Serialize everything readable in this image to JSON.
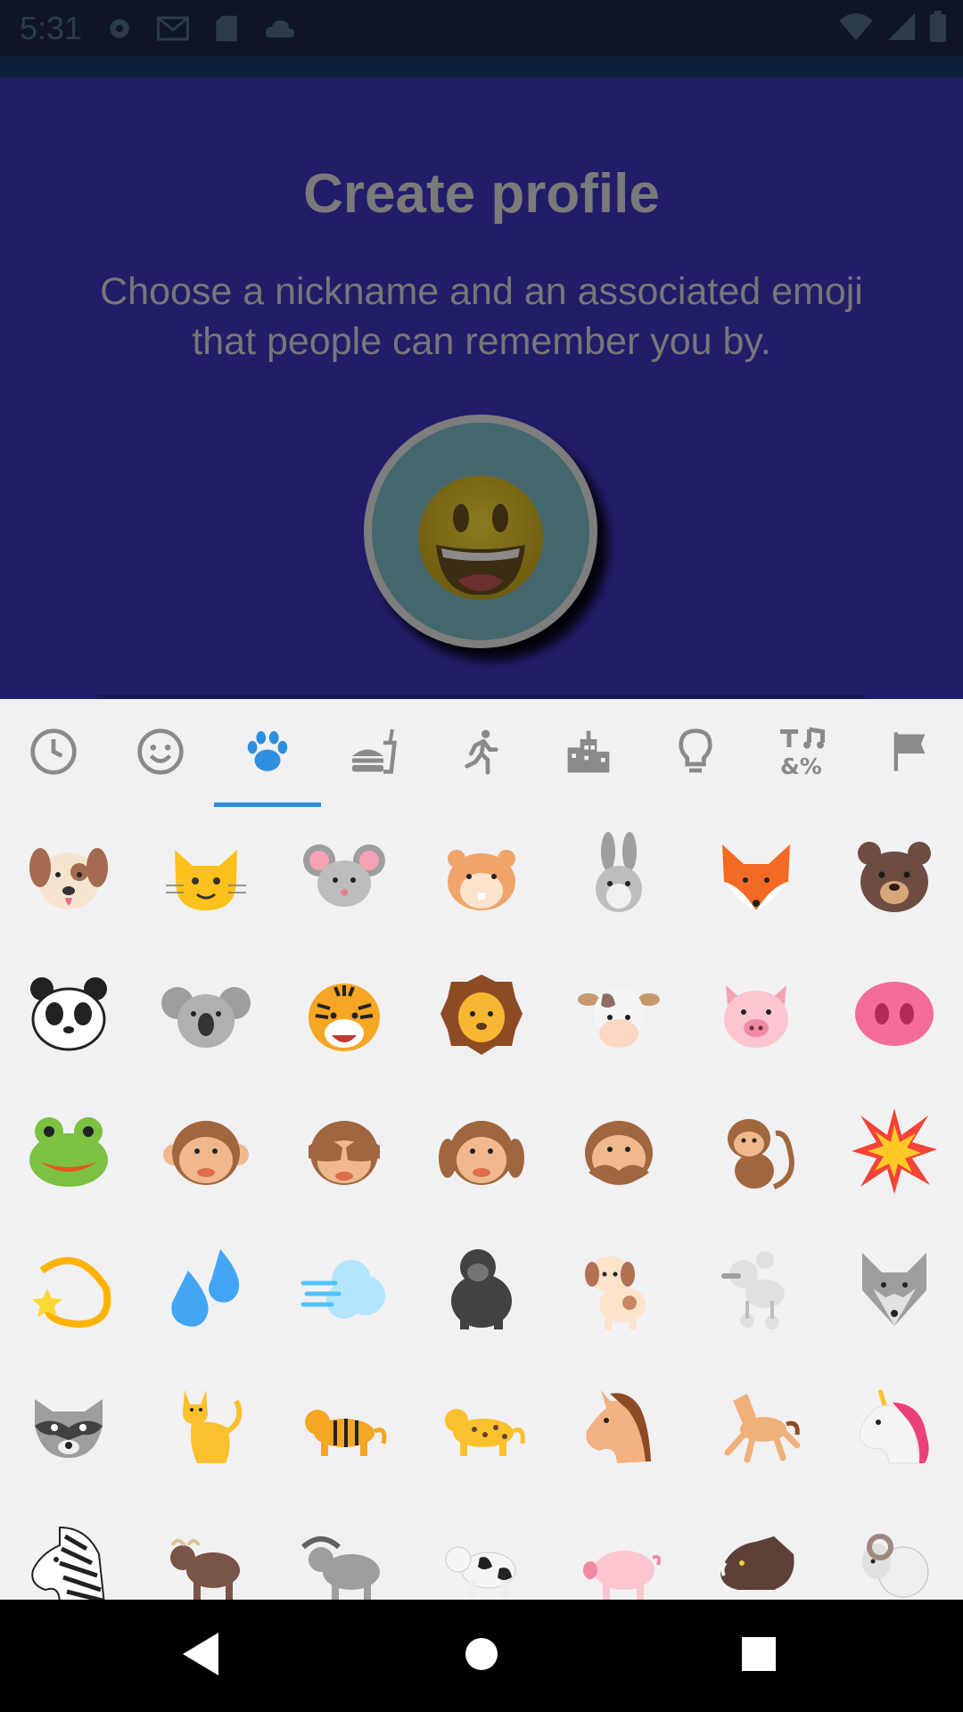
{
  "status_bar": {
    "time": "5:31"
  },
  "header": {
    "title": "Create profile",
    "subtitle": "Choose a nickname and an associated emoji that people can remember you by.",
    "selected_emoji": "grinning-face"
  },
  "tabs": [
    {
      "name": "recent",
      "icon": "clock-icon"
    },
    {
      "name": "smileys",
      "icon": "smiley-icon"
    },
    {
      "name": "animals",
      "icon": "paw-icon",
      "selected": true
    },
    {
      "name": "food",
      "icon": "food-icon"
    },
    {
      "name": "activity",
      "icon": "running-icon"
    },
    {
      "name": "places",
      "icon": "buildings-icon"
    },
    {
      "name": "objects",
      "icon": "lightbulb-icon"
    },
    {
      "name": "symbols",
      "icon": "symbols-icon"
    },
    {
      "name": "flags",
      "icon": "flag-icon"
    }
  ],
  "emoji_grid": [
    "dog-face",
    "cat-face",
    "mouse-face",
    "hamster",
    "rabbit-face",
    "fox",
    "bear",
    "panda",
    "koala",
    "tiger-face",
    "lion",
    "cow-face",
    "pig-face",
    "pig-nose",
    "frog",
    "monkey-face",
    "see-no-evil-monkey",
    "hear-no-evil-monkey",
    "speak-no-evil-monkey",
    "monkey",
    "collision",
    "dizzy",
    "sweat-droplets",
    "dashing-away",
    "gorilla",
    "dog",
    "poodle",
    "wolf",
    "raccoon",
    "cat",
    "tiger",
    "leopard",
    "horse-face",
    "horse",
    "unicorn",
    "zebra",
    "ox",
    "water-buffalo",
    "cow",
    "pig",
    "boar",
    "ram"
  ],
  "colors": {
    "header_bg": "#221d69",
    "accent": "#2f8fde",
    "panel_bg": "#f1f1f3"
  }
}
